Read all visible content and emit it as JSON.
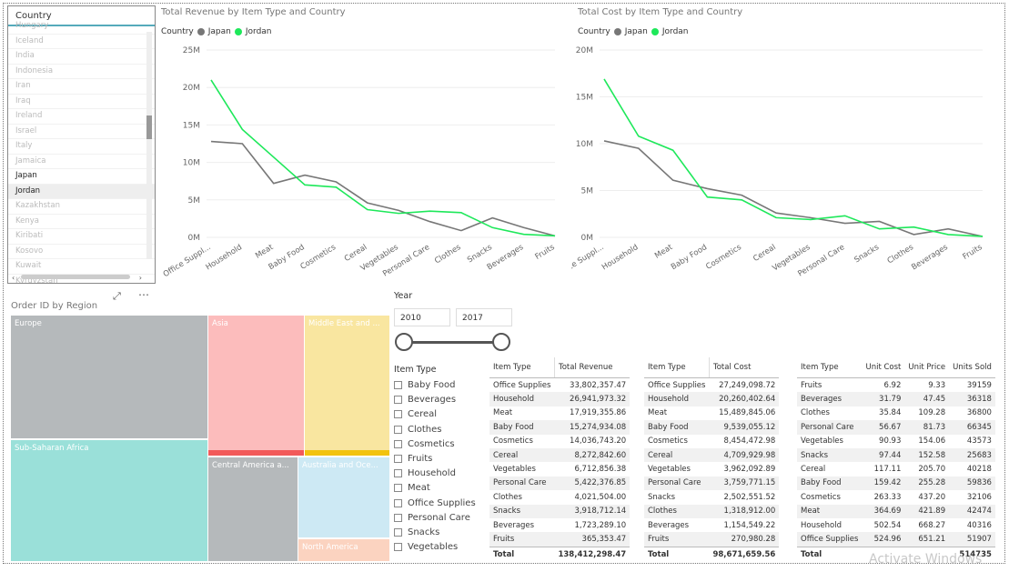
{
  "country_slicer": {
    "header": "Country",
    "items": [
      {
        "label": "Hungary",
        "selected": false
      },
      {
        "label": "Iceland",
        "selected": false
      },
      {
        "label": "India",
        "selected": false
      },
      {
        "label": "Indonesia",
        "selected": false
      },
      {
        "label": "Iran",
        "selected": false
      },
      {
        "label": "Iraq",
        "selected": false
      },
      {
        "label": "Ireland",
        "selected": false
      },
      {
        "label": "Israel",
        "selected": false
      },
      {
        "label": "Italy",
        "selected": false
      },
      {
        "label": "Jamaica",
        "selected": false
      },
      {
        "label": "Japan",
        "selected": true
      },
      {
        "label": "Jordan",
        "selected": true
      },
      {
        "label": "Kazakhstan",
        "selected": false
      },
      {
        "label": "Kenya",
        "selected": false
      },
      {
        "label": "Kiribati",
        "selected": false
      },
      {
        "label": "Kosovo",
        "selected": false
      },
      {
        "label": "Kuwait",
        "selected": false
      },
      {
        "label": "Kyrgyzstan",
        "selected": false
      }
    ]
  },
  "colors": {
    "japan": "#777777",
    "jordan": "#1ee85a"
  },
  "chart_data": [
    {
      "type": "line",
      "title": "Total Revenue by Item Type and Country",
      "legend_title": "Country",
      "legend_position": "top-left",
      "categories": [
        "Office Supplies",
        "Household",
        "Meat",
        "Baby Food",
        "Cosmetics",
        "Cereal",
        "Vegetables",
        "Personal Care",
        "Clothes",
        "Snacks",
        "Beverages",
        "Fruits"
      ],
      "category_labels": [
        "Office Suppl...",
        "Household",
        "Meat",
        "Baby Food",
        "Cosmetics",
        "Cereal",
        "Vegetables",
        "Personal Care",
        "Clothes",
        "Snacks",
        "Beverages",
        "Fruits"
      ],
      "yticks": [
        "25M",
        "20M",
        "15M",
        "10M",
        "5M",
        "0M"
      ],
      "ylim": [
        0,
        25000000
      ],
      "series": [
        {
          "name": "Japan",
          "values": [
            12800000,
            12500000,
            7200000,
            8300000,
            7400000,
            4600000,
            3600000,
            2100000,
            900000,
            2600000,
            1300000,
            200000
          ]
        },
        {
          "name": "Jordan",
          "values": [
            21000000,
            14400000,
            10700000,
            7000000,
            6700000,
            3700000,
            3200000,
            3500000,
            3300000,
            1300000,
            400000,
            200000
          ]
        }
      ]
    },
    {
      "type": "line",
      "title": "Total Cost by Item Type and Country",
      "legend_title": "Country",
      "legend_position": "top-left",
      "categories": [
        "Office Supplies",
        "Household",
        "Meat",
        "Baby Food",
        "Cosmetics",
        "Cereal",
        "Vegetables",
        "Personal Care",
        "Snacks",
        "Clothes",
        "Beverages",
        "Fruits"
      ],
      "category_labels": [
        "Office Suppl...",
        "Household",
        "Meat",
        "Baby Food",
        "Cosmetics",
        "Cereal",
        "Vegetables",
        "Personal Care",
        "Snacks",
        "Clothes",
        "Beverages",
        "Fruits"
      ],
      "yticks": [
        "20M",
        "15M",
        "10M",
        "5M",
        "0M"
      ],
      "ylim": [
        0,
        20000000
      ],
      "series": [
        {
          "name": "Japan",
          "values": [
            10300000,
            9500000,
            6100000,
            5200000,
            4500000,
            2600000,
            2100000,
            1500000,
            1700000,
            300000,
            900000,
            100000
          ]
        },
        {
          "name": "Jordan",
          "values": [
            16900000,
            10800000,
            9300000,
            4300000,
            4000000,
            2100000,
            1900000,
            2300000,
            900000,
            1100000,
            300000,
            100000
          ]
        }
      ]
    }
  ],
  "treemap": {
    "title": "Order ID by Region",
    "regions": [
      {
        "label": "Europe",
        "color": "#b5b9bb"
      },
      {
        "label": "Sub-Saharan Africa",
        "color": "#9ae0d9"
      },
      {
        "label": "Asia",
        "color": "#fcbcbc"
      },
      {
        "label": "Middle East and ...",
        "color": "#f9e6a0"
      },
      {
        "label": "Central America a...",
        "color": "#b5b9bb"
      },
      {
        "label": "Australia and Oce...",
        "color": "#cde9f4"
      },
      {
        "label": "North America",
        "color": "#fbd3c0"
      }
    ]
  },
  "year_slicer": {
    "title": "Year",
    "from": "2010",
    "to": "2017"
  },
  "item_slicer": {
    "title": "Item Type",
    "items": [
      "Baby Food",
      "Beverages",
      "Cereal",
      "Clothes",
      "Cosmetics",
      "Fruits",
      "Household",
      "Meat",
      "Office Supplies",
      "Personal Care",
      "Snacks",
      "Vegetables"
    ]
  },
  "table_revenue": {
    "headers": [
      "Item Type",
      "Total Revenue"
    ],
    "rows": [
      [
        "Office Supplies",
        "33,802,357.47"
      ],
      [
        "Household",
        "26,941,973.32"
      ],
      [
        "Meat",
        "17,919,355.86"
      ],
      [
        "Baby Food",
        "15,274,934.08"
      ],
      [
        "Cosmetics",
        "14,036,743.20"
      ],
      [
        "Cereal",
        "8,272,842.60"
      ],
      [
        "Vegetables",
        "6,712,856.38"
      ],
      [
        "Personal Care",
        "5,422,376.85"
      ],
      [
        "Clothes",
        "4,021,504.00"
      ],
      [
        "Snacks",
        "3,918,712.14"
      ],
      [
        "Beverages",
        "1,723,289.10"
      ],
      [
        "Fruits",
        "365,353.47"
      ]
    ],
    "total": [
      "Total",
      "138,412,298.47"
    ]
  },
  "table_cost": {
    "headers": [
      "Item Type",
      "Total Cost"
    ],
    "rows": [
      [
        "Office Supplies",
        "27,249,098.72"
      ],
      [
        "Household",
        "20,260,402.64"
      ],
      [
        "Meat",
        "15,489,845.06"
      ],
      [
        "Baby Food",
        "9,539,055.12"
      ],
      [
        "Cosmetics",
        "8,454,472.98"
      ],
      [
        "Cereal",
        "4,709,929.98"
      ],
      [
        "Vegetables",
        "3,962,092.89"
      ],
      [
        "Personal Care",
        "3,759,771.15"
      ],
      [
        "Snacks",
        "2,502,551.52"
      ],
      [
        "Clothes",
        "1,318,912.00"
      ],
      [
        "Beverages",
        "1,154,549.22"
      ],
      [
        "Fruits",
        "270,980.28"
      ]
    ],
    "total": [
      "Total",
      "98,671,659.56"
    ]
  },
  "table_units": {
    "headers": [
      "Item Type",
      "Unit Cost",
      "Unit Price",
      "Units Sold"
    ],
    "rows": [
      [
        "Fruits",
        "6.92",
        "9.33",
        "39159"
      ],
      [
        "Beverages",
        "31.79",
        "47.45",
        "36318"
      ],
      [
        "Clothes",
        "35.84",
        "109.28",
        "36800"
      ],
      [
        "Personal Care",
        "56.67",
        "81.73",
        "66345"
      ],
      [
        "Vegetables",
        "90.93",
        "154.06",
        "43573"
      ],
      [
        "Snacks",
        "97.44",
        "152.58",
        "25683"
      ],
      [
        "Cereal",
        "117.11",
        "205.70",
        "40218"
      ],
      [
        "Baby Food",
        "159.42",
        "255.28",
        "59836"
      ],
      [
        "Cosmetics",
        "263.33",
        "437.20",
        "32106"
      ],
      [
        "Meat",
        "364.69",
        "421.89",
        "42474"
      ],
      [
        "Household",
        "502.54",
        "668.27",
        "40316"
      ],
      [
        "Office Supplies",
        "524.96",
        "651.21",
        "51907"
      ]
    ],
    "total": [
      "Total",
      "",
      "",
      "514735"
    ]
  },
  "watermark": "Activate Windows"
}
